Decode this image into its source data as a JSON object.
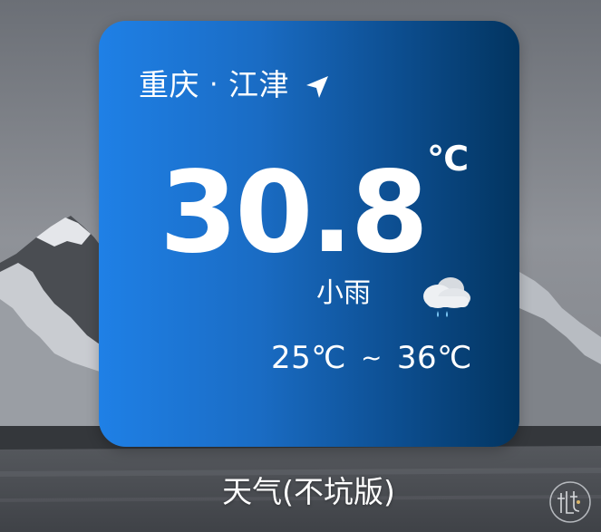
{
  "widget": {
    "location": {
      "city": "重庆",
      "separator": "·",
      "district": "江津",
      "icon": "location-arrow-icon"
    },
    "temperature": {
      "value": "30.8",
      "unit": "℃"
    },
    "condition": {
      "text": "小雨",
      "icon": "light-rain-cloud-icon"
    },
    "range": {
      "low": "25℃",
      "separator": "~",
      "high": "36℃"
    },
    "name": "天气(不坑版)"
  },
  "colors": {
    "card_gradient_start": "#1f80e6",
    "card_gradient_end": "#02345f",
    "text": "#ffffff",
    "rain_drop": "#7cc7f5"
  }
}
